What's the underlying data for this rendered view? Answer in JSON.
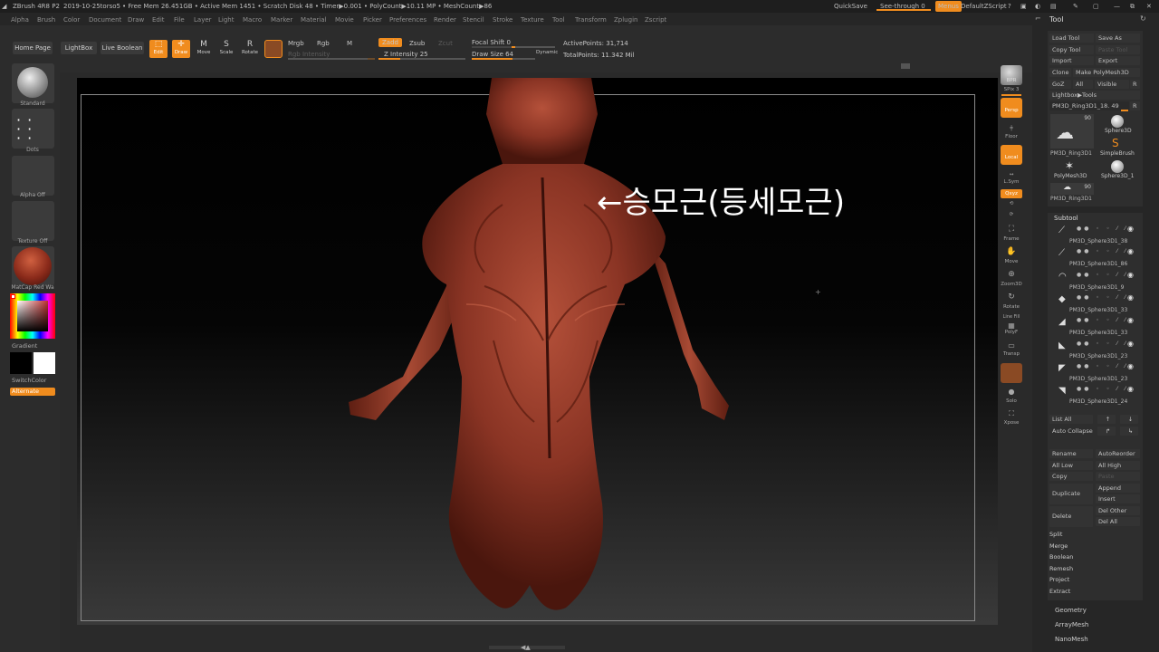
{
  "title_bar": {
    "app": "ZBrush 4R8 P2",
    "doc": "2019-10-25torso5",
    "stats": "• Free Mem 26.451GB • Active Mem 1451 • Scratch Disk 48 • Timer▶0.001 • PolyCount▶10.11 MP • MeshCount▶86",
    "quicksave": "QuickSave",
    "see_through": "See-through  0",
    "menus": "Menus",
    "script": "DefaultZScript"
  },
  "menu_items": [
    "Alpha",
    "Brush",
    "Color",
    "Document",
    "Draw",
    "Edit",
    "File",
    "Layer",
    "Light",
    "Macro",
    "Marker",
    "Material",
    "Movie",
    "Picker",
    "Preferences",
    "Render",
    "Stencil",
    "Stroke",
    "Texture",
    "Tool",
    "Transform",
    "Zplugin",
    "Zscript"
  ],
  "toolbar": {
    "home_page": "Home Page",
    "lightbox": "LightBox",
    "live_boolean": "Live Boolean",
    "edit": "Edit",
    "draw": "Draw",
    "move": "Move",
    "scale": "Scale",
    "rotate": "Rotate",
    "mrgb": "Mrgb",
    "rgb": "Rgb",
    "m": "M",
    "rgb_intensity": "Rgb Intensity",
    "zadd": "Zadd",
    "zsub": "Zsub",
    "zcut": "Zcut",
    "z_intensity": "Z Intensity 25",
    "focal_shift": "Focal Shift 0",
    "draw_size": "Draw Size 64",
    "dynamic": "Dynamic",
    "active_points": "ActivePoints: 31,714",
    "total_points": "TotalPoints: 11.342 Mil",
    "z_intensity_value": 25,
    "draw_size_value": 64
  },
  "left_shelf": {
    "brush": "Standard",
    "stroke": "Dots",
    "alpha": "Alpha Off",
    "texture": "Texture Off",
    "material": "MatCap Red Wa",
    "gradient": "Gradient",
    "switch_color": "SwitchColor",
    "alternate": "Alternate"
  },
  "viewport": {
    "annotation": "←승모근(등세모근)"
  },
  "right_shelf": {
    "bpr": "BPR",
    "spix": "SPix 3",
    "persp": "Persp",
    "floor": "Floor",
    "local": "Local",
    "lsym": "L.Sym",
    "xyz": "Qxyz",
    "frame": "Frame",
    "move": "Move",
    "zoom3d": "Zoom3D",
    "rotate": "Rotate",
    "polyf": "PolyF",
    "line_fill": "Line Fill",
    "transp": "Transp",
    "solo": "Solo",
    "xpose": "Xpose"
  },
  "tool_panel": {
    "title": "Tool",
    "load_tool": "Load Tool",
    "save_as": "Save As",
    "copy_tool": "Copy Tool",
    "paste_tool": "Paste Tool",
    "import": "Import",
    "export": "Export",
    "clone": "Clone",
    "make_polymesh": "Make PolyMesh3D",
    "goz": "GoZ",
    "all": "All",
    "visible": "Visible",
    "r": "R",
    "lightbox_tools": "Lightbox▶Tools",
    "current_tool": "PM3D_Ring3D1_18. 49",
    "thumb_count": "90",
    "thumb_name": "PM3D_Ring3D1",
    "sphere3d": "Sphere3D",
    "simplebrush": "SimpleBrush",
    "polymesh3d": "PolyMesh3D",
    "sphere3d_1": "Sphere3D_1",
    "thumb_count2": "90",
    "thumb_name2": "PM3D_Ring3D1",
    "subtool": "Subtool",
    "subtools": [
      "PM3D_Sphere3D1_38",
      "PM3D_Sphere3D1_86",
      "PM3D_Sphere3D1_9",
      "PM3D_Sphere3D1_33",
      "PM3D_Sphere3D1_33",
      "PM3D_Sphere3D1_23",
      "PM3D_Sphere3D1_23",
      "PM3D_Sphere3D1_24"
    ],
    "list_all": "List All",
    "auto_collapse": "Auto Collapse",
    "rename": "Rename",
    "auto_reorder": "AutoReorder",
    "all_low": "All Low",
    "all_high": "All High",
    "copy": "Copy",
    "paste": "Paste",
    "append": "Append",
    "duplicate": "Duplicate",
    "insert": "Insert",
    "delete": "Delete",
    "del_other": "Del Other",
    "del_all": "Del All",
    "split": "Split",
    "merge": "Merge",
    "boolean": "Boolean",
    "remesh": "Remesh",
    "project": "Project",
    "extract": "Extract",
    "geometry": "Geometry",
    "arraymesh": "ArrayMesh",
    "nanomesh": "NanoMesh"
  },
  "colors": {
    "accent": "#f08c1e",
    "panel": "#262626",
    "model": "#8a3a2a"
  }
}
